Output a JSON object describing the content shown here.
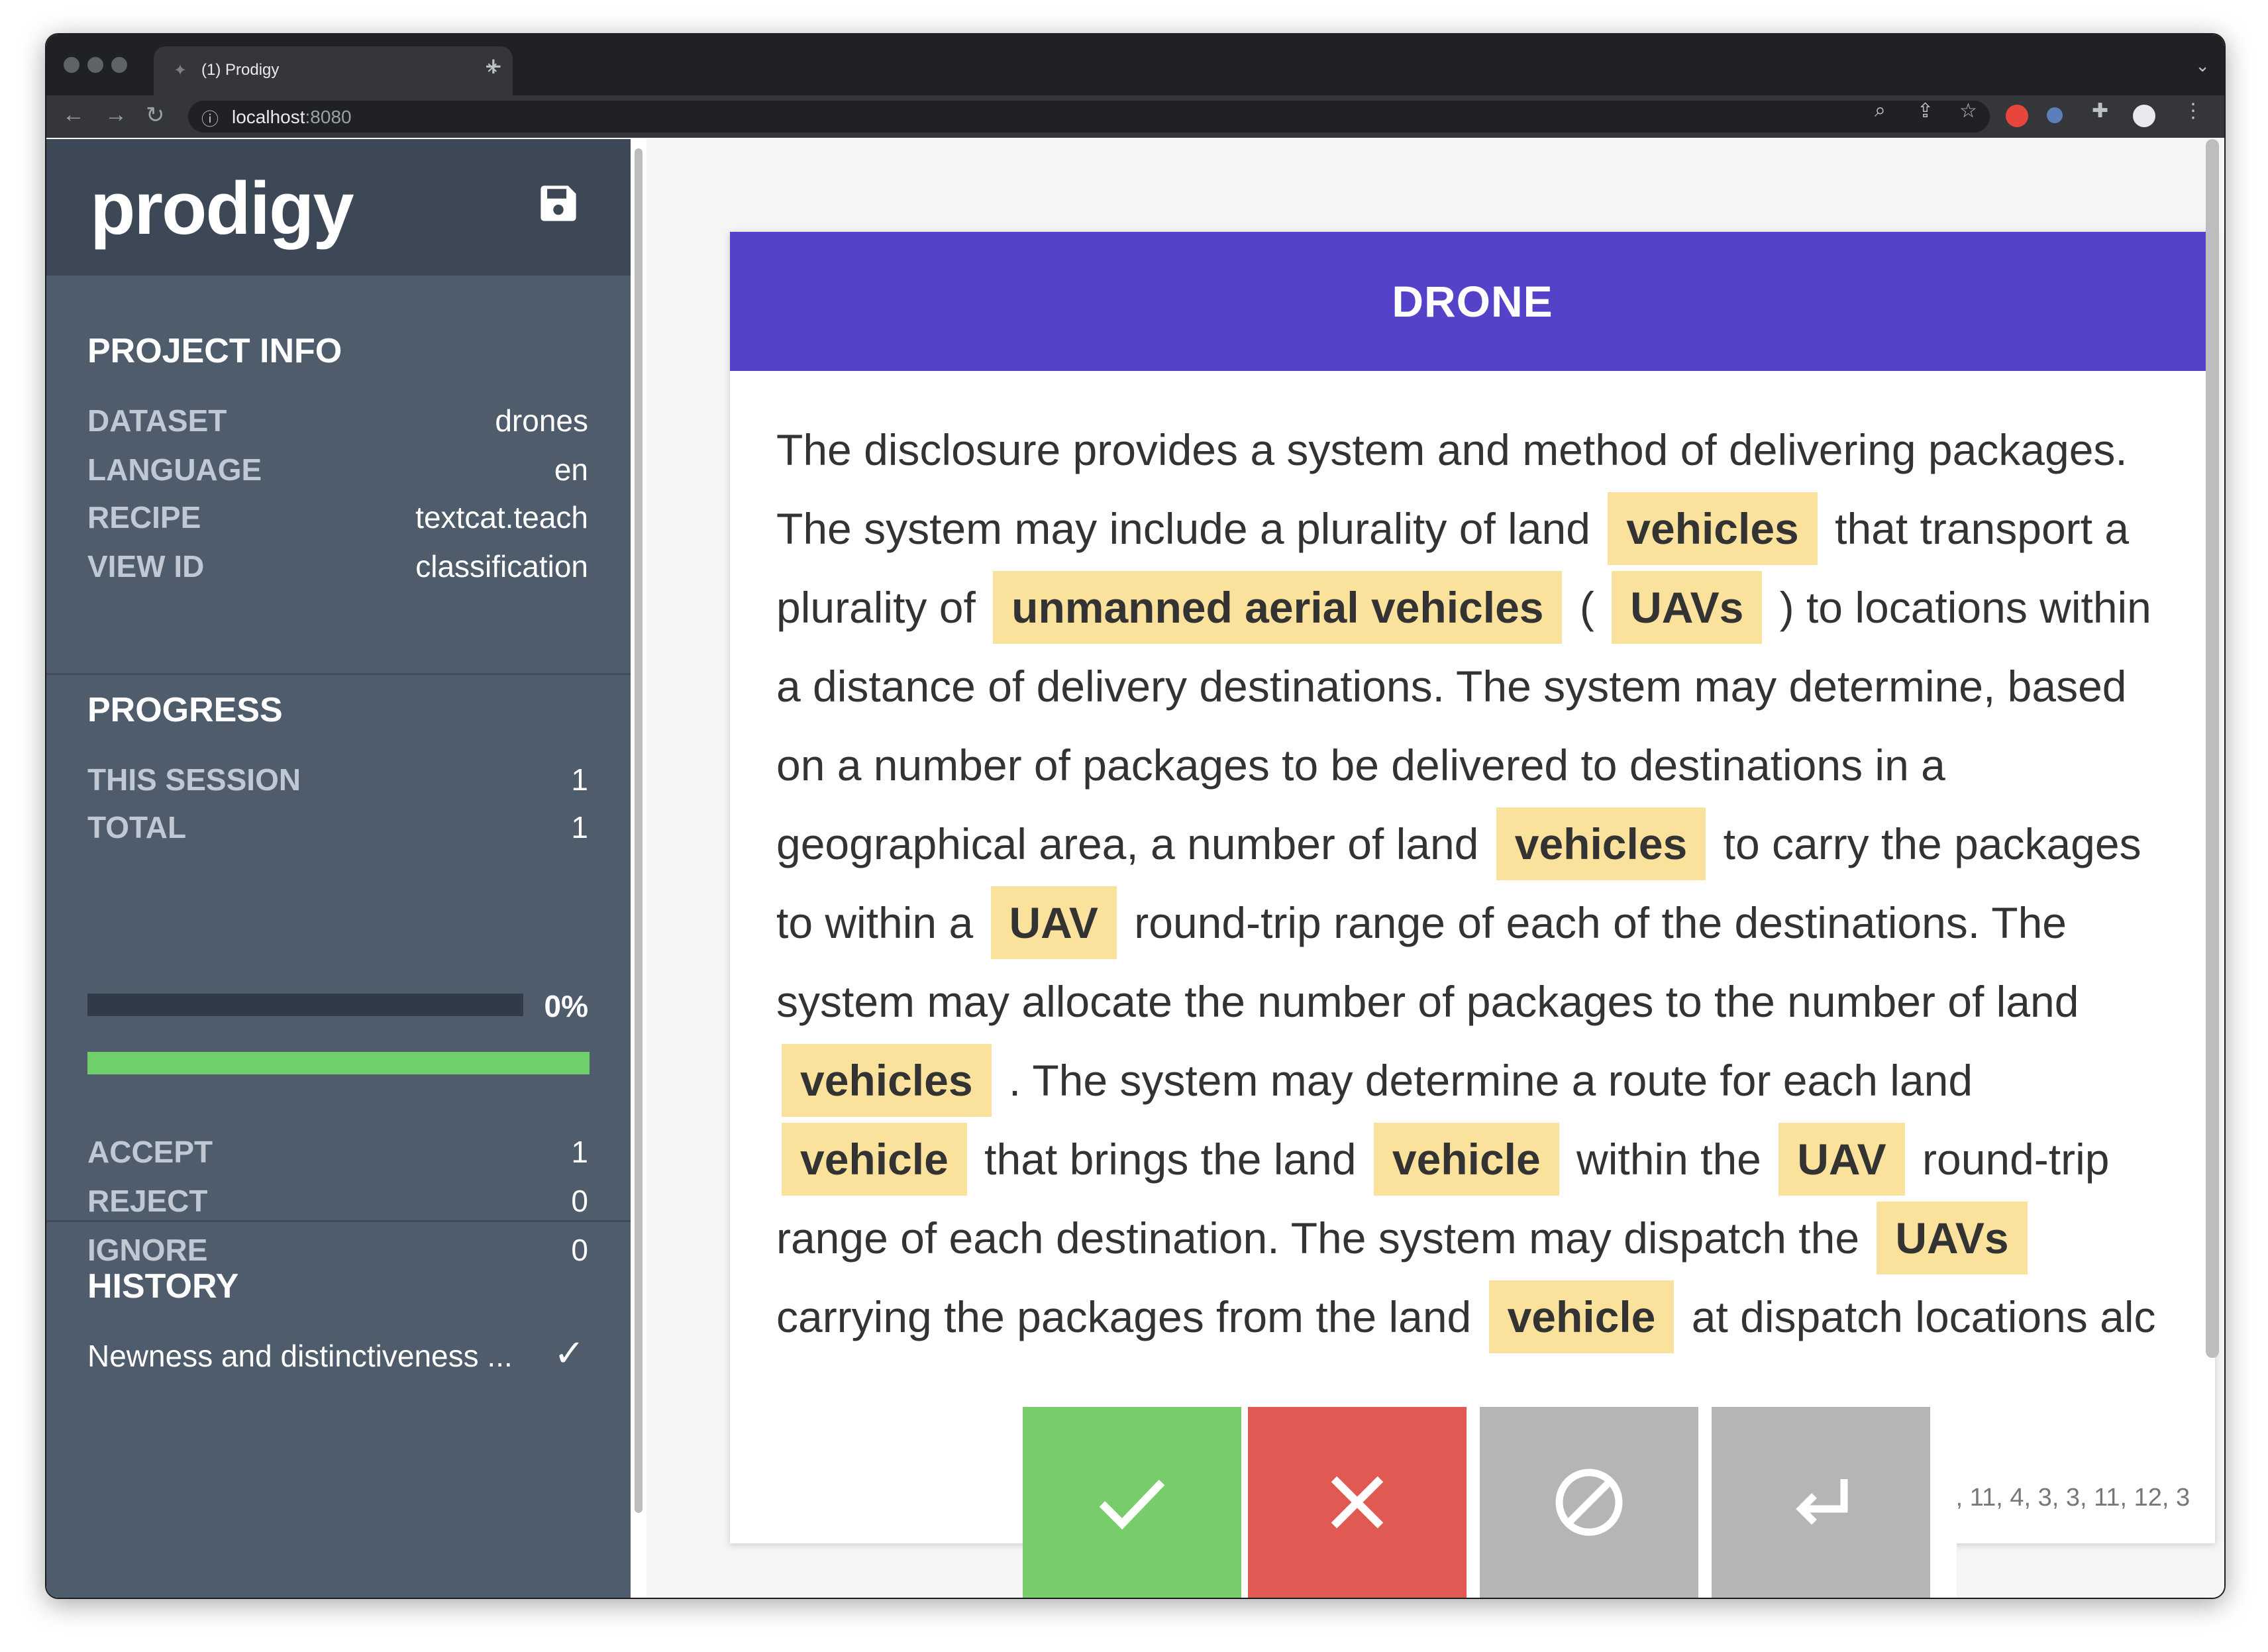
{
  "browser": {
    "tab_title": "(1) Prodigy",
    "url_host": "localhost",
    "url_port": ":8080"
  },
  "sidebar": {
    "logo": "prodigy",
    "project_info": {
      "title": "PROJECT INFO",
      "rows": [
        {
          "key": "DATASET",
          "value": "drones"
        },
        {
          "key": "LANGUAGE",
          "value": "en"
        },
        {
          "key": "RECIPE",
          "value": "textcat.teach"
        },
        {
          "key": "VIEW ID",
          "value": "classification"
        }
      ]
    },
    "progress": {
      "title": "PROGRESS",
      "this_session_label": "THIS SESSION",
      "this_session": "1",
      "total_label": "TOTAL",
      "total": "1",
      "percent": "0%",
      "accept_label": "ACCEPT",
      "accept": "1",
      "reject_label": "REJECT",
      "reject": "0",
      "ignore_label": "IGNORE",
      "ignore": "0"
    },
    "history": {
      "title": "HISTORY",
      "items": [
        "Newness and distinctiveness ..."
      ]
    }
  },
  "card": {
    "label": "DRONE",
    "text_segments": [
      {
        "t": "The disclosure provides a system and method of delivering packages. The system may include a plurality of land ",
        "hl": false
      },
      {
        "t": "vehicles",
        "hl": true
      },
      {
        "t": " that transport a plurality of ",
        "hl": false
      },
      {
        "t": "unmanned aerial vehicles",
        "hl": true
      },
      {
        "t": " ( ",
        "hl": false
      },
      {
        "t": "UAVs",
        "hl": true
      },
      {
        "t": " ) to locations within a distance of delivery destinations. The system may determine, based on a number of packages to be delivered to destinations in a geographical area, a number of land ",
        "hl": false
      },
      {
        "t": "vehicles",
        "hl": true
      },
      {
        "t": " to carry the packages to within a ",
        "hl": false
      },
      {
        "t": "UAV",
        "hl": true
      },
      {
        "t": " round-trip range of each of the destinations. The system may allocate the number of packages to the number of land ",
        "hl": false
      },
      {
        "t": "vehicles",
        "hl": true
      },
      {
        "t": " . The system may determine a route for each land ",
        "hl": false
      },
      {
        "t": "vehicle",
        "hl": true
      },
      {
        "t": " that brings the land ",
        "hl": false
      },
      {
        "t": "vehicle",
        "hl": true
      },
      {
        "t": " within the ",
        "hl": false
      },
      {
        "t": "UAV",
        "hl": true
      },
      {
        "t": " round-trip range of each destination. The system may dispatch the ",
        "hl": false
      },
      {
        "t": "UAVs",
        "hl": true
      },
      {
        "t": " carrying the packages from the land ",
        "hl": false
      },
      {
        "t": "vehicle",
        "hl": true
      },
      {
        "t": " at dispatch locations alc",
        "hl": false
      }
    ],
    "meta": "·, 11, 4, 3, 3, 11, 12, 3"
  },
  "actions": {
    "accept_color": "#78cd6b",
    "reject_color": "#e05a53",
    "ignore_color": "#b5b5b5",
    "undo_color": "#b5b5b5"
  },
  "colors": {
    "label_bg": "#5443c8",
    "highlight": "#fbe29c",
    "sidebar_bg": "#4f5c6b"
  }
}
